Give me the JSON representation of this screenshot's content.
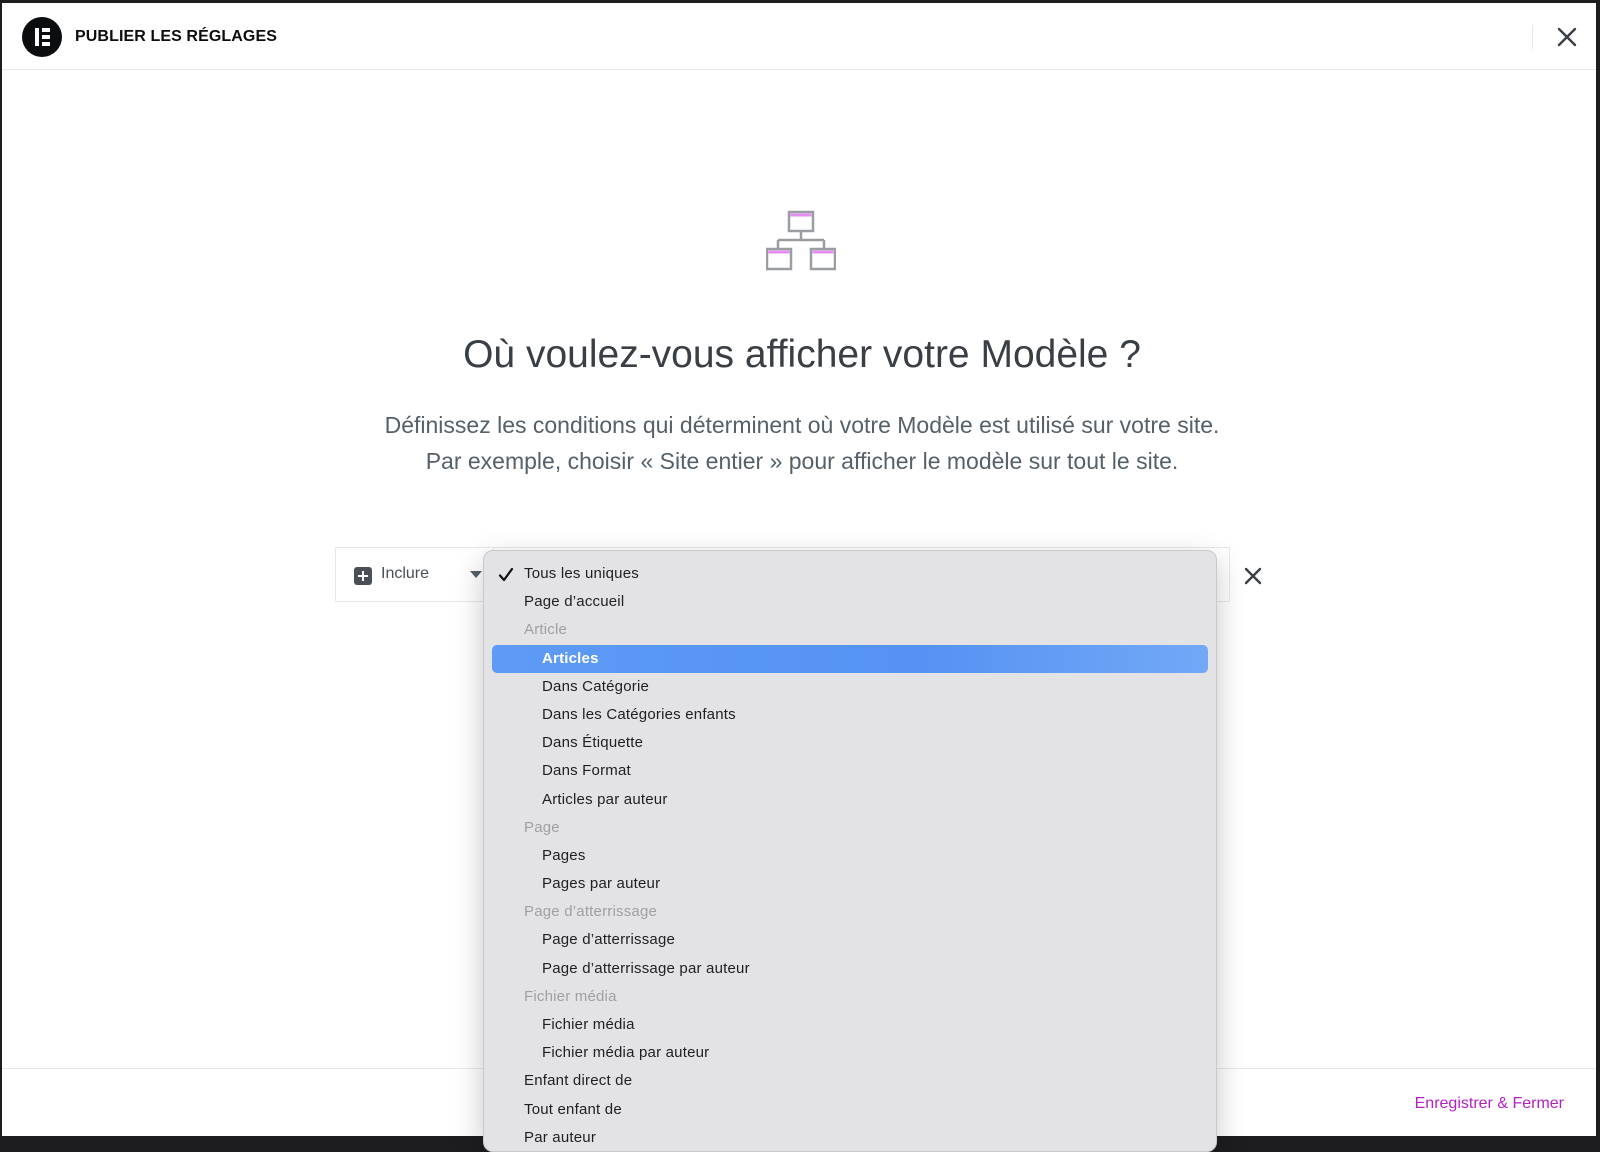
{
  "header": {
    "title": "PUBLIER LES RÉGLAGES"
  },
  "main": {
    "heading": "Où voulez-vous afficher votre Modèle ?",
    "description_line1": "Définissez les conditions qui déterminent où votre Modèle est utilisé sur votre site.",
    "description_line2": "Par exemple, choisir « Site entier » pour afficher le modèle sur tout le site."
  },
  "condition": {
    "type_label": "Inclure"
  },
  "dropdown": {
    "items": [
      {
        "label": "Tous les uniques",
        "kind": "option",
        "checked": true
      },
      {
        "label": "Page d’accueil",
        "kind": "option"
      },
      {
        "label": "Article",
        "kind": "group"
      },
      {
        "label": "Articles",
        "kind": "sub",
        "highlighted": true
      },
      {
        "label": "Dans Catégorie",
        "kind": "sub"
      },
      {
        "label": "Dans les Catégories enfants",
        "kind": "sub"
      },
      {
        "label": "Dans Étiquette",
        "kind": "sub"
      },
      {
        "label": "Dans Format",
        "kind": "sub"
      },
      {
        "label": "Articles par auteur",
        "kind": "sub"
      },
      {
        "label": "Page",
        "kind": "group"
      },
      {
        "label": "Pages",
        "kind": "sub"
      },
      {
        "label": "Pages par auteur",
        "kind": "sub"
      },
      {
        "label": "Page d’atterrissage",
        "kind": "group"
      },
      {
        "label": "Page d’atterrissage",
        "kind": "sub"
      },
      {
        "label": "Page d’atterrissage par auteur",
        "kind": "sub"
      },
      {
        "label": "Fichier média",
        "kind": "group"
      },
      {
        "label": "Fichier média",
        "kind": "sub"
      },
      {
        "label": "Fichier média par auteur",
        "kind": "sub"
      },
      {
        "label": "Enfant direct de",
        "kind": "option"
      },
      {
        "label": "Tout enfant de",
        "kind": "option"
      },
      {
        "label": "Par auteur",
        "kind": "option"
      }
    ]
  },
  "footer": {
    "save_close_label": "Enregistrer & Fermer"
  },
  "colors": {
    "accent": "#b520c4",
    "highlight": "#5592f3",
    "icon_accent": "#e48ef0"
  }
}
